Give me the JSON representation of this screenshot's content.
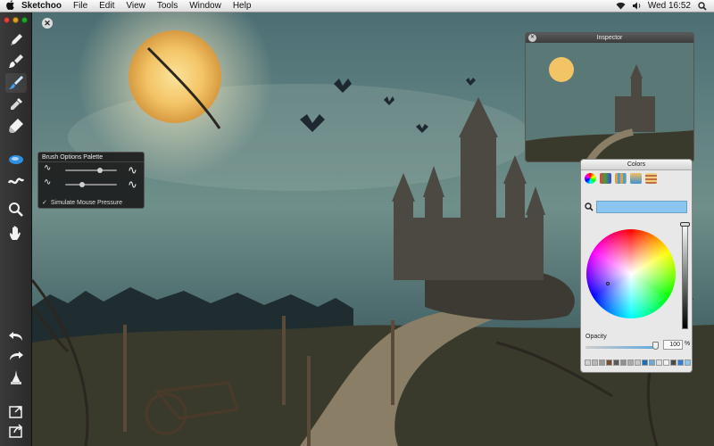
{
  "menubar": {
    "app_name": "Sketchoo",
    "menus": [
      "File",
      "Edit",
      "View",
      "Tools",
      "Window",
      "Help"
    ],
    "clock": "Wed 16:52"
  },
  "brush_palette": {
    "title": "Brush Options Palette",
    "simulate_label": "Simulate Mouse Pressure",
    "simulate_checked": true,
    "slider1_level": 0.7,
    "slider2_level": 0.33
  },
  "inspector": {
    "title": "Inspector"
  },
  "colors_panel": {
    "title": "Colors",
    "opacity_label": "Opacity",
    "opacity_value": "100",
    "opacity_unit": "%",
    "selected_color": "#8ac6ef",
    "swatches": [
      "#d0d0d0",
      "#b8b8b8",
      "#9a9a9a",
      "#7c4a2e",
      "#5a5a5a",
      "#8f8f8f",
      "#aaaaaa",
      "#c6c6c6",
      "#1a6fbd",
      "#6aa9d9",
      "#e0e0e0",
      "#f2f2f2",
      "#4a4a4a",
      "#2f7fd0",
      "#8ac6ef",
      "#ffffff"
    ]
  }
}
